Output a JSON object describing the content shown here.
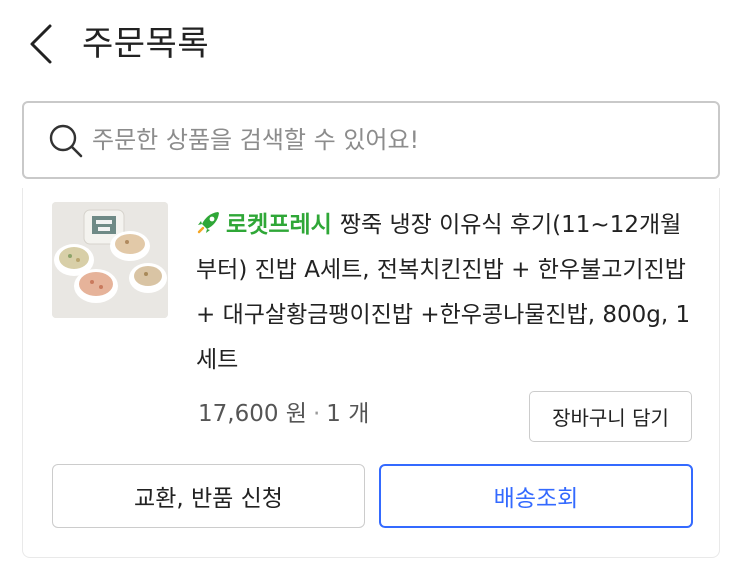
{
  "header": {
    "back_icon": "chevron-left-icon",
    "title": "주문목록"
  },
  "search": {
    "icon": "search-icon",
    "placeholder": "주문한 상품을 검색할 수 있어요!",
    "value": ""
  },
  "order": {
    "badge_icon": "rocket-icon",
    "badge_label": "로켓프레시",
    "badge_color": "#2fa737",
    "product_name": "짱죽 냉장 이유식 후기(11~12개월부터) 진밥 A세트, 전복치킨진밥 + 한우불고기진밥 + 대구살황금팽이진밥 +한우콩나물진밥, 800g, 1세트",
    "price": "17,600 원",
    "separator": "·",
    "quantity": "1 개",
    "cart_button": "장바구니 담기",
    "exchange_button": "교환, 반품 신청",
    "tracking_button": "배송조회",
    "accent_color": "#346aff"
  }
}
